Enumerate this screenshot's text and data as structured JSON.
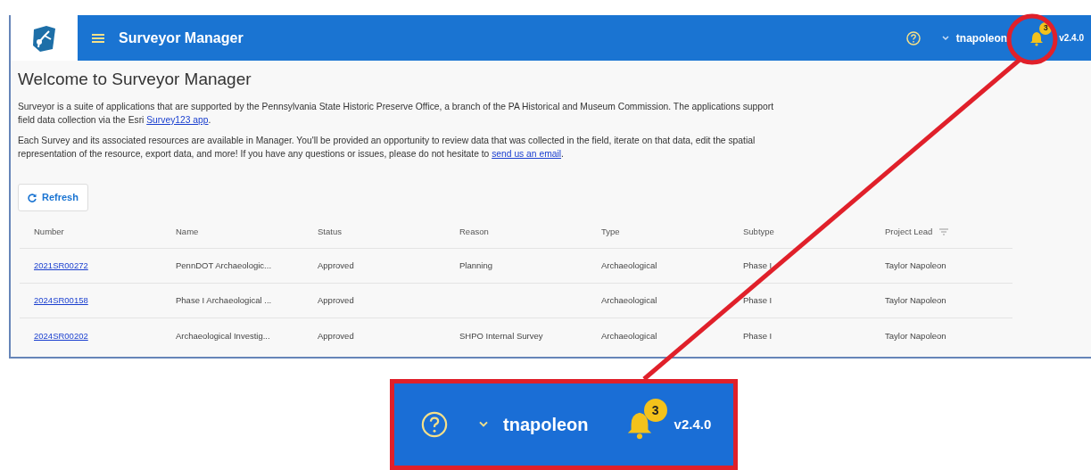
{
  "app": {
    "title": "Surveyor Manager",
    "user": "tnapoleon",
    "notifications": "3",
    "version": "v2.4.0"
  },
  "heading": "Welcome to Surveyor Manager",
  "paragraphs": [
    {
      "before": "Surveyor is a suite of applications that are supported by the Pennsylvania State Historic Preserve Office, a branch of the PA Historical and Museum Commission. The applications support field data collection via the Esri ",
      "link": "Survey123 app",
      "after": "."
    },
    {
      "before": "Each Survey and its associated resources are available in Manager. You'll be provided an opportunity to review data that was collected in the field, iterate on that data, edit the spatial representation of the resource, export data, and more! If you have any questions or issues, please do not hesitate to ",
      "link": "send us an email",
      "after": "."
    }
  ],
  "refresh_button": "Refresh",
  "table": {
    "columns": [
      {
        "label": "Number",
        "filter": false
      },
      {
        "label": "Name",
        "filter": false
      },
      {
        "label": "Status",
        "filter": false
      },
      {
        "label": "Reason",
        "filter": false
      },
      {
        "label": "Type",
        "filter": false
      },
      {
        "label": "Subtype",
        "filter": false
      },
      {
        "label": "Project Lead",
        "filter": true
      }
    ],
    "rows": [
      [
        "2021SR00272",
        "PennDOT Archaeologic...",
        "Approved",
        "Planning",
        "Archaeological",
        "Phase I",
        "Taylor Napoleon"
      ],
      [
        "2024SR00158",
        "Phase I Archaeological ...",
        "Approved",
        "",
        "Archaeological",
        "Phase I",
        "Taylor Napoleon"
      ],
      [
        "2024SR00202",
        "Archaeological Investig...",
        "Approved",
        "SHPO Internal Survey",
        "Archaeological",
        "Phase I",
        "Taylor Napoleon"
      ]
    ]
  },
  "callout": {
    "user": "tnapoleon",
    "notifications": "3",
    "version": "v2.4.0"
  }
}
